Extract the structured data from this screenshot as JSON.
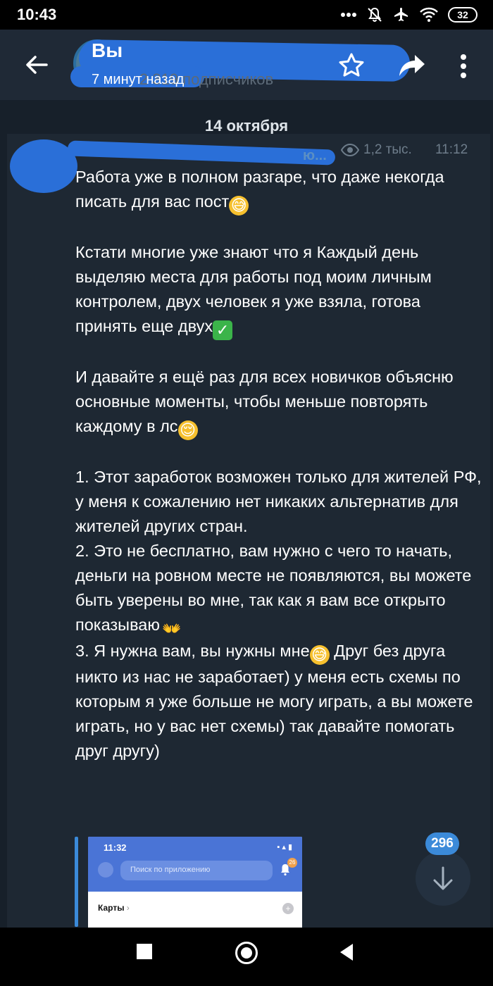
{
  "status_bar": {
    "time": "10:43",
    "battery": "32",
    "icons": [
      "more-dots-icon",
      "mute-bell-icon",
      "airplane-icon",
      "wifi-icon",
      "battery-icon"
    ]
  },
  "header": {
    "title": "Вы",
    "subtitle": "7 минут назад",
    "faded_subscribers": "2 319 подписчиков",
    "actions": [
      "back-arrow-icon",
      "star-icon",
      "share-icon",
      "more-vertical-icon"
    ]
  },
  "chat": {
    "date": "14 октября",
    "post": {
      "name_tail": "ю...",
      "views": "1,2 тыс.",
      "time": "11:12",
      "paragraphs": [
        "Работа уже в полном разгаре, что даже некогда писать для вас пост",
        "Кстати многие уже знают что я Каждый день выделяю места для работы под моим личным контролем, двух человек я уже взяла, готова принять еще двух",
        "И давайте я ещё раз для всех новичков объясню основные моменты, чтобы меньше повторять каждому в лс",
        "1. Этот заработок возможен только для жителей РФ, у меня к сожалению нет никаких альтернатив для жителей других стран.",
        "2. Это не бесплатно, вам нужно с чего то начать, деньги на ровном месте не появляются, вы можете быть уверены во мне, так как я вам все открыто показываю",
        "3. Я нужна вам, вы нужны мне",
        " Друг без друга никто из нас не заработает) у меня есть схемы по которым я уже больше не могу играть, а вы можете играть, но у вас нет схемы) так давайте помогать друг другу)"
      ],
      "emoji": {
        "sweat": "😅",
        "check": "✓",
        "relieved": "😌",
        "hands": "👐"
      }
    },
    "preview": {
      "time": "11:32",
      "search_placeholder": "Поиск по приложению",
      "badge": "26",
      "cards_label": "Карты",
      "cards_chevron": "›",
      "plus": "+"
    },
    "unread_count": "296"
  },
  "colors": {
    "background": "#17202a",
    "header": "#1f2936",
    "accent": "#3b8ad9",
    "redaction": "#2a6fd8"
  }
}
